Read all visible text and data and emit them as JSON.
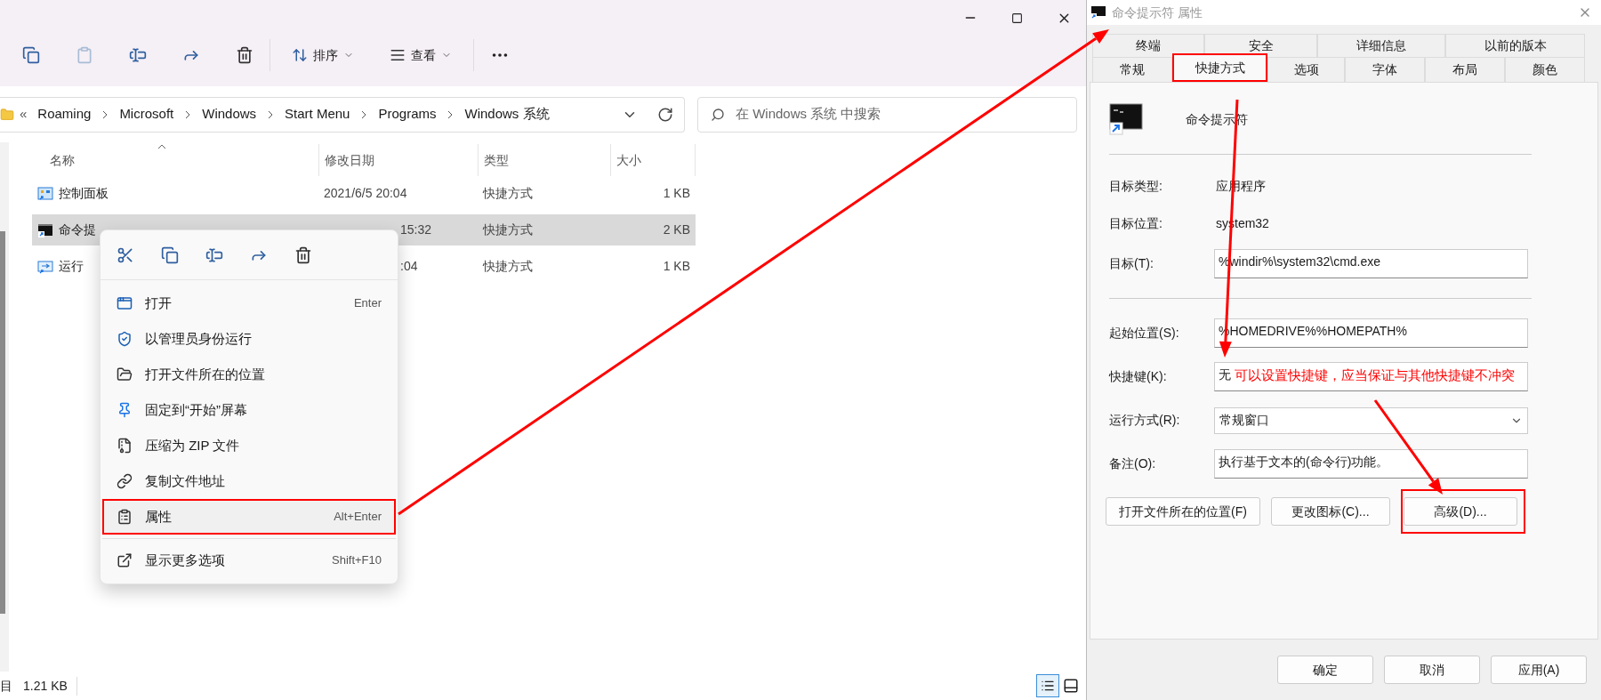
{
  "explorer": {
    "toolbar": {
      "sort_label": "排序",
      "view_label": "查看"
    },
    "breadcrumb": {
      "overflow": "«",
      "parts": [
        "Roaming",
        "Microsoft",
        "Windows",
        "Start Menu",
        "Programs",
        "Windows 系统"
      ]
    },
    "search": {
      "placeholder": "在 Windows 系统 中搜索"
    },
    "columns": [
      "名称",
      "修改日期",
      "类型",
      "大小"
    ],
    "rows": [
      {
        "kind": "control",
        "name": "控制面板",
        "modified": "2021/6/5 20:04",
        "type": "快捷方式",
        "size": "1 KB",
        "selected": false,
        "covered": false
      },
      {
        "kind": "cmd",
        "name": "命令提",
        "modified": "15:32",
        "type": "快捷方式",
        "size": "2 KB",
        "selected": true,
        "covered": true
      },
      {
        "kind": "run",
        "name": "运行",
        "modified": ":04",
        "type": "快捷方式",
        "size": "1 KB",
        "selected": false,
        "covered": true
      }
    ],
    "status": {
      "items_fragment": "目",
      "size": "1.21 KB"
    }
  },
  "context_menu": {
    "items": [
      {
        "kind": "command",
        "label": "打开",
        "shortcut": "Enter",
        "highlighted": false
      },
      {
        "kind": "command",
        "label": "以管理员身份运行",
        "highlighted": false
      },
      {
        "kind": "command",
        "label": "打开文件所在的位置",
        "highlighted": false
      },
      {
        "kind": "command",
        "label": "固定到“开始”屏幕",
        "highlighted": false
      },
      {
        "kind": "command",
        "label": "压缩为 ZIP 文件",
        "highlighted": false
      },
      {
        "kind": "command",
        "label": "复制文件地址",
        "highlighted": false
      },
      {
        "kind": "command",
        "label": "属性",
        "shortcut": "Alt+Enter",
        "highlighted": true
      },
      {
        "kind": "separator"
      },
      {
        "kind": "command",
        "label": "显示更多选项",
        "shortcut": "Shift+F10",
        "highlighted": false
      }
    ]
  },
  "dialog": {
    "title": "命令提示符 属性",
    "tabs_back": [
      {
        "label": "终端",
        "selected": false
      },
      {
        "label": "安全",
        "selected": false
      },
      {
        "label": "详细信息",
        "selected": false
      },
      {
        "label": "以前的版本",
        "selected": false
      }
    ],
    "tabs_front": [
      {
        "label": "常规",
        "selected": false,
        "highlighted": false
      },
      {
        "label": "快捷方式",
        "selected": true,
        "highlighted": true
      },
      {
        "label": "选项",
        "selected": false,
        "highlighted": false
      },
      {
        "label": "字体",
        "selected": false,
        "highlighted": false
      },
      {
        "label": "布局",
        "selected": false,
        "highlighted": false
      },
      {
        "label": "颜色",
        "selected": false,
        "highlighted": false
      }
    ],
    "app_name": "命令提示符",
    "fields": [
      {
        "kind": "separator"
      },
      {
        "kind": "info",
        "label": "目标类型:",
        "value": "应用程序"
      },
      {
        "kind": "info",
        "label": "目标位置:",
        "value": "system32"
      },
      {
        "kind": "input",
        "label": "目标(T):",
        "value": "%windir%\\system32\\cmd.exe"
      },
      {
        "kind": "separator"
      },
      {
        "kind": "input",
        "label": "起始位置(S):",
        "value": "%HOMEDRIVE%%HOMEPATH%"
      },
      {
        "kind": "input",
        "label": "快捷键(K):",
        "value": "无",
        "note": "可以设置快捷键，应当保证与其他快捷键不冲突"
      },
      {
        "kind": "dropdown",
        "label": "运行方式(R):",
        "value": "常规窗口"
      },
      {
        "kind": "input",
        "label": "备注(O):",
        "value": "执行基于文本的(命令行)功能。"
      }
    ],
    "buttons": [
      {
        "label": "打开文件所在的位置(F)",
        "highlighted": false
      },
      {
        "label": "更改图标(C)...",
        "highlighted": false
      },
      {
        "label": "高级(D)...",
        "highlighted": true
      }
    ],
    "footer_buttons": [
      "确定",
      "取消",
      "应用(A)"
    ]
  }
}
